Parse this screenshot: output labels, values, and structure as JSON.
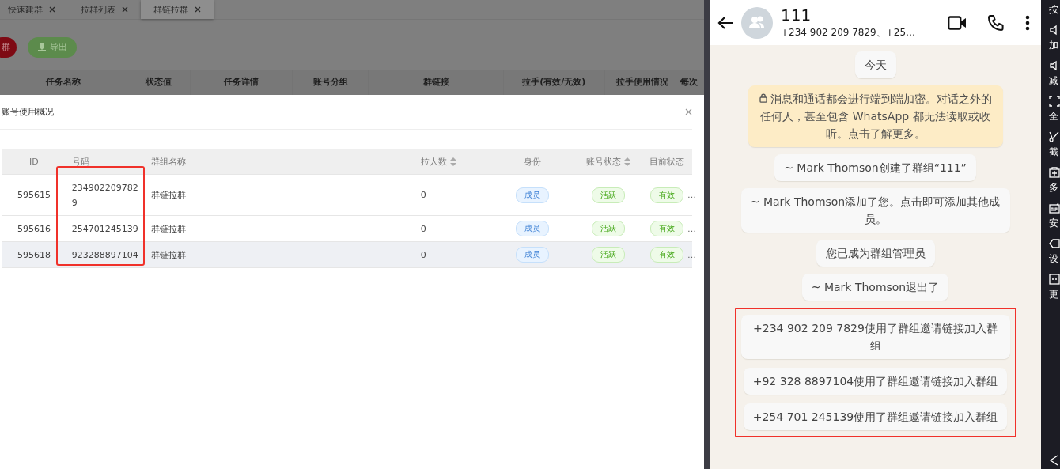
{
  "background_page": {
    "tabs": [
      {
        "label": "快速建群",
        "selected": false
      },
      {
        "label": "拉群列表",
        "selected": false
      },
      {
        "label": "群链拉群",
        "selected": true
      }
    ],
    "buttons": [
      {
        "label": "群",
        "kind": "danger"
      },
      {
        "label": "导出",
        "kind": "export"
      }
    ],
    "columns": [
      "任务名称",
      "状态值",
      "任务详情",
      "账号分组",
      "群链接",
      "拉手(有效/无效)",
      "拉手使用情况",
      "每次"
    ]
  },
  "dialog": {
    "title": "账号使用概况",
    "columns": [
      {
        "label": "ID",
        "sortable": false,
        "highlighted": false
      },
      {
        "label": "号码",
        "sortable": false,
        "highlighted": true
      },
      {
        "label": "群组名称",
        "sortable": false,
        "highlighted": false
      },
      {
        "label": "拉人数",
        "sortable": true,
        "highlighted": false
      },
      {
        "label": "身份",
        "sortable": false,
        "highlighted": false
      },
      {
        "label": "账号状态",
        "sortable": true,
        "highlighted": false
      },
      {
        "label": "目前状态",
        "sortable": false,
        "highlighted": false
      }
    ],
    "rows": [
      {
        "hovered": false,
        "cells": [
          "595615",
          "2349022097829",
          "群链拉群",
          "0",
          "成员",
          "活跃",
          "有效"
        ],
        "more": "…"
      },
      {
        "hovered": false,
        "cells": [
          "595616",
          "254701245139",
          "群链拉群",
          "0",
          "成员",
          "活跃",
          "有效"
        ],
        "more": "…"
      },
      {
        "hovered": true,
        "cells": [
          "595618",
          "923288897104",
          "群链拉群",
          "0",
          "成员",
          "活跃",
          "有效"
        ],
        "more": "…"
      }
    ]
  },
  "chat": {
    "title": "111",
    "subtitle": "+234 902 209 7829、+25…",
    "messages": [
      {
        "kind": "date",
        "text": "今天",
        "highlighted": false
      },
      {
        "kind": "encryption",
        "text": "消息和通话都会进行端到端加密。对话之外的任何人，甚至包含 WhatsApp 都无法读取或收听。点击了解更多。",
        "highlighted": false
      },
      {
        "kind": "system",
        "text": "~ Mark Thomson创建了群组“111”",
        "highlighted": false
      },
      {
        "kind": "system",
        "text": "~ Mark Thomson添加了您。点击即可添加其他成员。",
        "highlighted": false
      },
      {
        "kind": "system",
        "text": "您已成为群组管理员",
        "highlighted": false
      },
      {
        "kind": "system",
        "text": "~ Mark Thomson退出了",
        "highlighted": false
      },
      {
        "kind": "system",
        "text": "+234 902 209 7829使用了群组邀请链接加入群组",
        "highlighted": true
      },
      {
        "kind": "system",
        "text": "+92 328 8897104使用了群组邀请链接加入群组",
        "highlighted": true
      },
      {
        "kind": "system",
        "text": "+254 701 245139使用了群组邀请链接加入群组",
        "highlighted": true
      }
    ]
  },
  "side_toolbar": [
    {
      "kind": "text",
      "label": "按"
    },
    {
      "kind": "speaker",
      "label": "加"
    },
    {
      "kind": "speaker",
      "label": "减"
    },
    {
      "kind": "fullscreen",
      "label": "全"
    },
    {
      "kind": "scissors",
      "label": "截"
    },
    {
      "kind": "plusbox",
      "label": "多"
    },
    {
      "kind": "apk",
      "label": "安"
    },
    {
      "kind": "tag",
      "label": "设"
    },
    {
      "kind": "dots",
      "label": "更"
    },
    {
      "kind": "back"
    }
  ]
}
